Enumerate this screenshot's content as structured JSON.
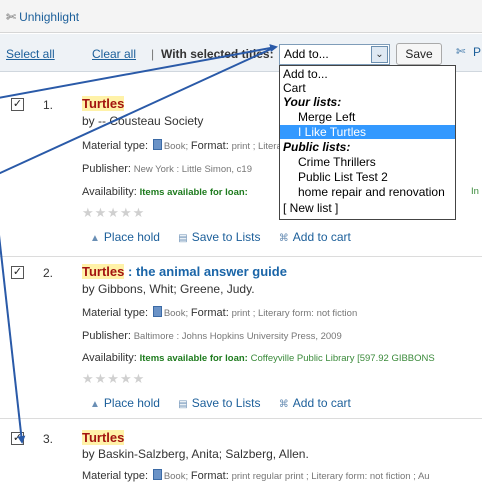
{
  "toolbar": {
    "unhighlight": "Unhighlight",
    "pen_glyph": "✄",
    "select_all": "Select all",
    "clear_all": "Clear all",
    "separator": "|",
    "with_selected": "With selected titles:",
    "add_to_value": "Add to...",
    "save_label": "Save",
    "partial_label": "P"
  },
  "dropdown": {
    "options": [
      "Add to...",
      "Cart",
      "Your lists:",
      "Merge Left",
      "I Like Turtles",
      "Public lists:",
      "Crime Thrillers",
      "Public List Test 2",
      "home repair and renovation",
      "[ New list ]"
    ],
    "selected": "I Like Turtles"
  },
  "results": [
    {
      "checked": true,
      "number": "1.",
      "title": "Turtles",
      "author": "by -- Cousteau Society",
      "material_key": "Material type:",
      "material_val": "Book;",
      "format_key": "Format:",
      "format_val": "print ; Literary form: not fiction ; Ju",
      "publisher_key": "Publisher:",
      "publisher_val": "New York : Little Simon, c19",
      "availability_key": "Availability:",
      "availability_val": "Items available for loan:",
      "availability_loc": "In",
      "actions": [
        "Place hold",
        "Save to Lists",
        "Add to cart"
      ]
    },
    {
      "checked": true,
      "number": "2.",
      "title": "Turtles",
      "title_rest": " : the animal answer guide",
      "author": "by Gibbons, Whit; Greene, Judy.",
      "material_key": "Material type:",
      "material_val": "Book;",
      "format_key": "Format:",
      "format_val": "print ; Literary form: not fiction",
      "publisher_key": "Publisher:",
      "publisher_val": "Baltimore : Johns Hopkins University Press, 2009",
      "availability_key": "Availability:",
      "availability_val": "Items available for loan:",
      "availability_loc": "Coffeyville Public Library [597.92 GIBBONS",
      "actions": [
        "Place hold",
        "Save to Lists",
        "Add to cart"
      ]
    },
    {
      "checked": true,
      "number": "3.",
      "title": "Turtles",
      "author": "by Baskin-Salzberg, Anita; Salzberg, Allen.",
      "material_key": "Material type:",
      "material_val": "Book;",
      "format_key": "Format:",
      "format_val": "print regular print ; Literary form: not fiction ; Au"
    }
  ],
  "icons": {
    "rating_stars": "★★★★★",
    "checkmark": "✓",
    "dropdown_arrow": "⌄",
    "hold_icon": "▲",
    "list_icon": "▤",
    "cart_icon": "⌘"
  },
  "colors": {
    "link": "#1c5f9a",
    "highlight": "#fff2a8",
    "annotation_arrow": "#2a5aa8",
    "selection": "#3399ff"
  }
}
